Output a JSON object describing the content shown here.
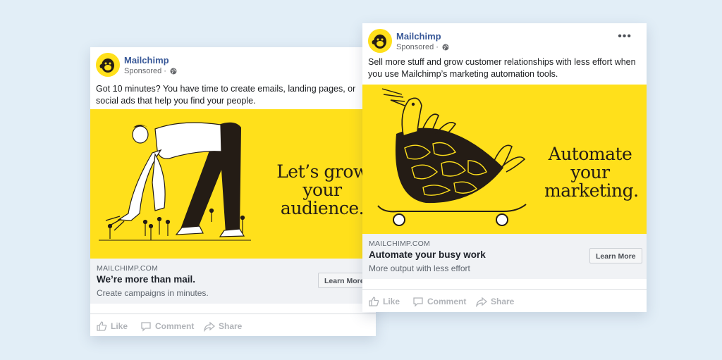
{
  "ads": [
    {
      "brand": "Mailchimp",
      "sponsored": "Sponsored ·",
      "text": "Got 10 minutes? You have time to create emails, landing pages, or social ads that help you find your people.",
      "image_headline": "Let’s grow your audience.",
      "link": {
        "domain": "MAILCHIMP.COM",
        "title": "We’re more than mail.",
        "description": "Create campaigns in minutes.",
        "cta": "Learn More"
      },
      "actions": {
        "like": "Like",
        "comment": "Comment",
        "share": "Share"
      }
    },
    {
      "brand": "Mailchimp",
      "sponsored": "Sponsored ·",
      "menu": "•••",
      "text": "Sell more stuff and grow customer relationships with less effort when you use Mailchimp’s marketing automation tools.",
      "image_headline": "Automate your marketing.",
      "link": {
        "domain": "MAILCHIMP.COM",
        "title": "Automate your busy work",
        "description": "More output with less effort",
        "cta": "Learn More"
      },
      "actions": {
        "like": "Like",
        "comment": "Comment",
        "share": "Share"
      }
    }
  ],
  "colors": {
    "brand_yellow": "#ffe01b",
    "link_blue": "#385898",
    "background": "#e2eef7"
  },
  "icons": [
    "mailchimp-logo",
    "globe-icon",
    "like-icon",
    "comment-icon",
    "share-icon",
    "more-options-icon"
  ]
}
